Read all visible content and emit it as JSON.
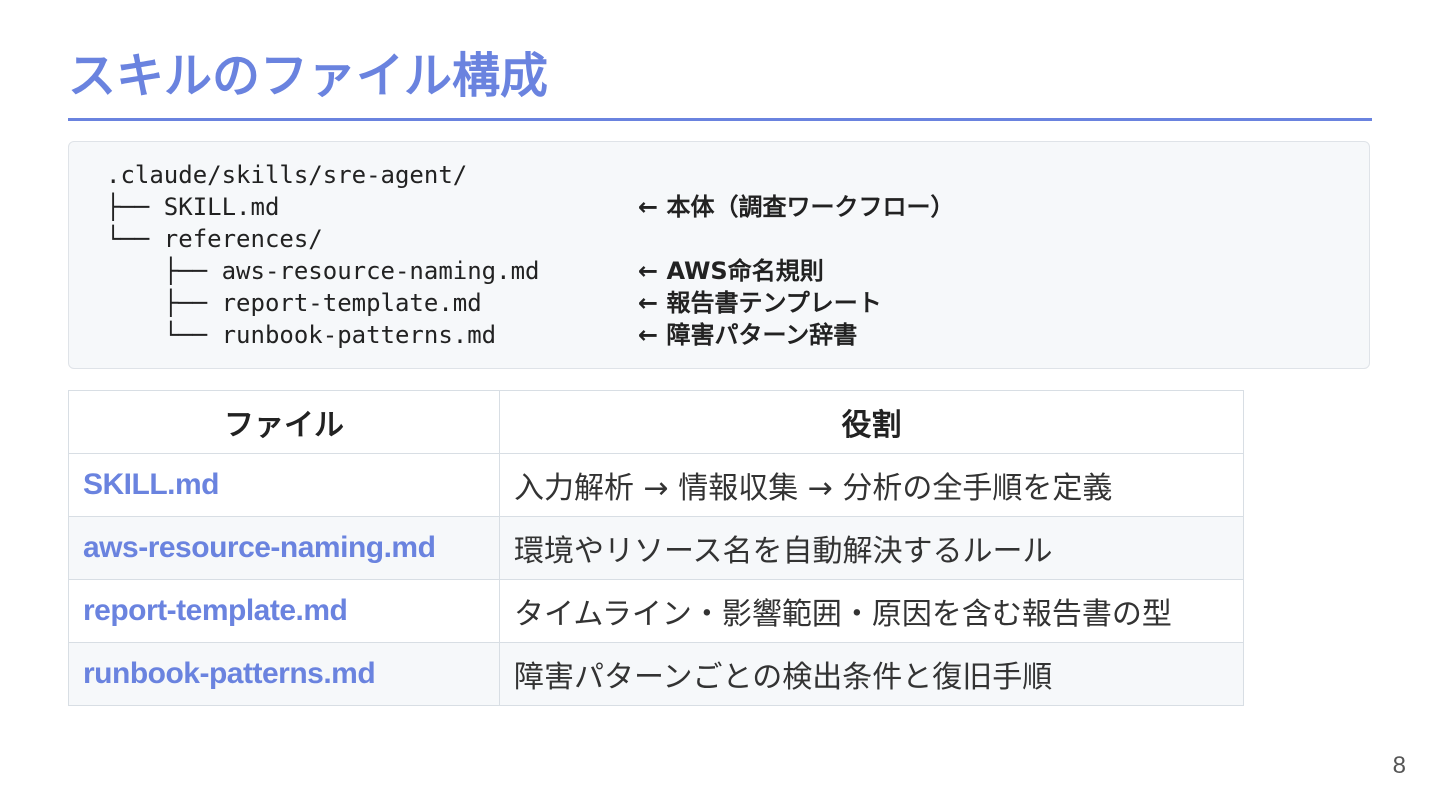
{
  "slide": {
    "title": "スキルのファイル構成",
    "page_number": "8",
    "accent_color": "#6a83df"
  },
  "tree": {
    "lines": [
      {
        "code": ".claude/skills/sre-agent/",
        "note": ""
      },
      {
        "code": "├── SKILL.md",
        "note": "← 本体（調査ワークフロー）"
      },
      {
        "code": "└── references/",
        "note": ""
      },
      {
        "code": "    ├── aws-resource-naming.md",
        "note": "← AWS命名規則"
      },
      {
        "code": "    ├── report-template.md",
        "note": "← 報告書テンプレート"
      },
      {
        "code": "    └── runbook-patterns.md",
        "note": "← 障害パターン辞書"
      }
    ]
  },
  "table": {
    "headers": [
      "ファイル",
      "役割"
    ],
    "rows": [
      {
        "file": "SKILL.md",
        "role": "入力解析 → 情報収集 → 分析の全手順を定義"
      },
      {
        "file": "aws-resource-naming.md",
        "role": "環境やリソース名を自動解決するルール"
      },
      {
        "file": "report-template.md",
        "role": "タイムライン・影響範囲・原因を含む報告書の型"
      },
      {
        "file": "runbook-patterns.md",
        "role": "障害パターンごとの検出条件と復旧手順"
      }
    ]
  }
}
